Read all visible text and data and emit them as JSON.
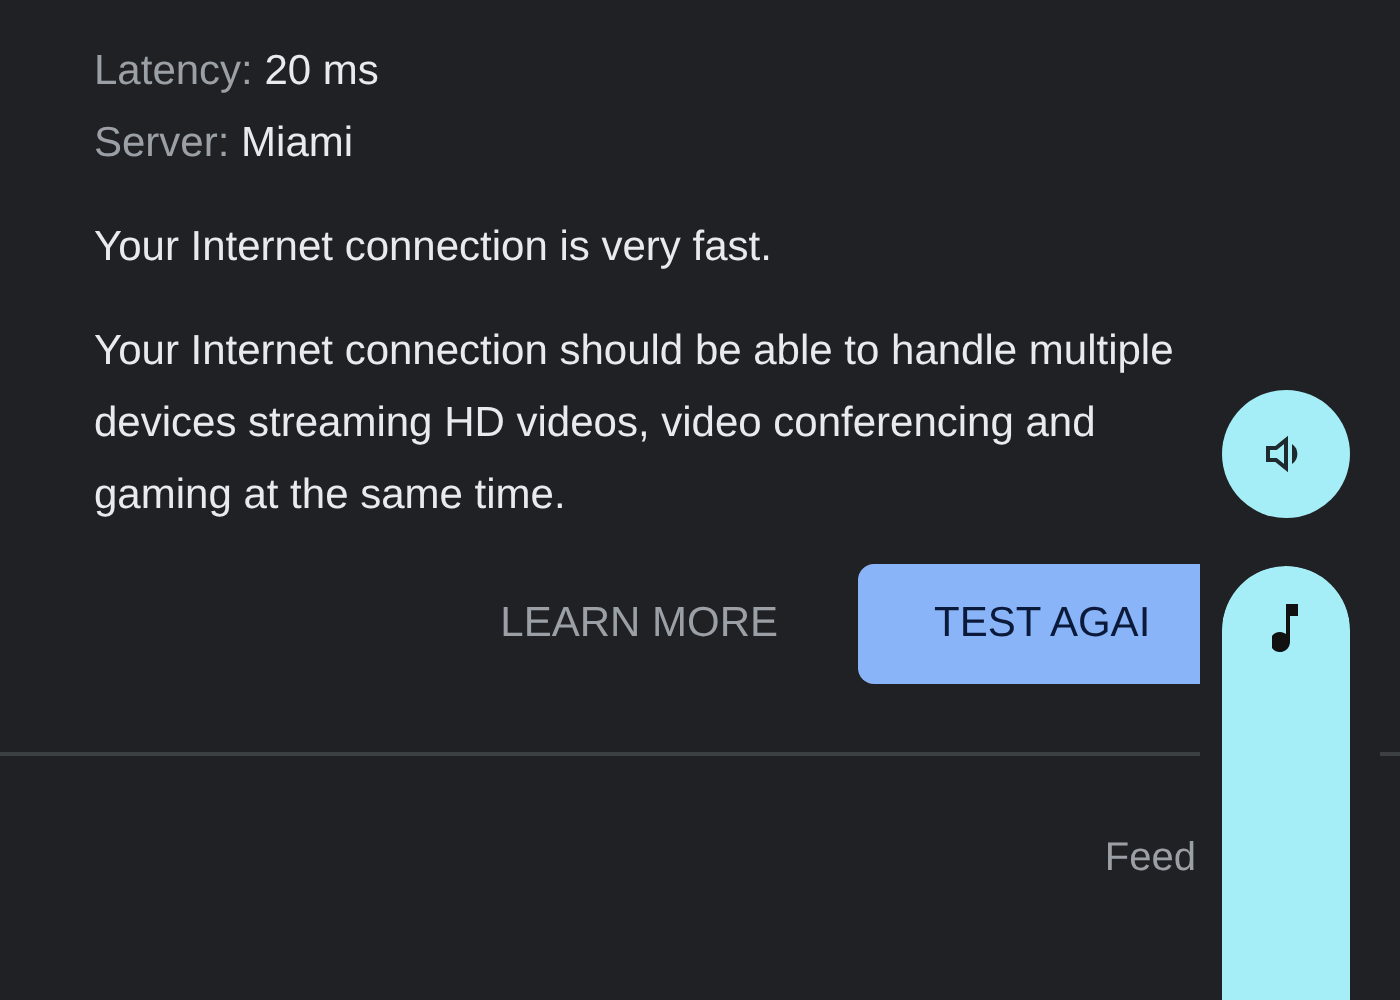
{
  "details": [
    {
      "label": "Latency:",
      "value": "20 ms"
    },
    {
      "label": "Server:",
      "value": "Miami"
    }
  ],
  "summary": "Your Internet connection is very fast.",
  "description": "Your Internet connection should be able to handle multiple devices streaming HD videos, video conferencing and gaming at the same time.",
  "buttons": [
    {
      "label": "LEARN MORE",
      "kind": "text"
    },
    {
      "label": "TEST AGAI",
      "kind": "filled"
    }
  ],
  "footer": {
    "link": "Feed"
  },
  "volume": {
    "level": 1
  }
}
